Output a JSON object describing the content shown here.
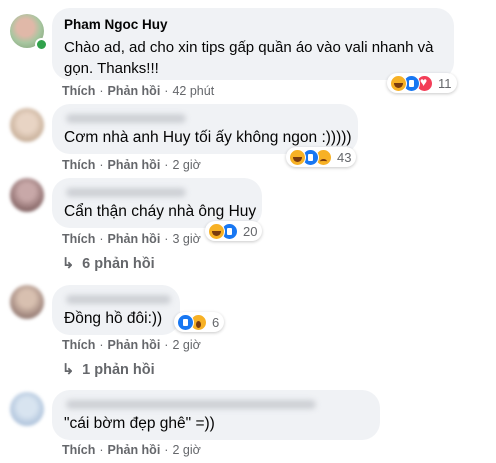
{
  "colors": {
    "bubble": "#f0f2f5",
    "muted": "#65676b",
    "online": "#31a24c",
    "like": "#1877f2",
    "love": "#f33e58",
    "haha": "#f7b125"
  },
  "action_labels": {
    "like": "Thích",
    "reply": "Phản hồi"
  },
  "comments": [
    {
      "author": "Pham Ngoc Huy",
      "lines": [
        "Chào ad, ad cho xin tips gấp quần áo vào vali nhanh và",
        "gọn. Thanks!!!"
      ],
      "time": "42 phút",
      "reaction_icons": [
        "haha-icon",
        "like-icon",
        "love-icon"
      ],
      "reaction_count": "11"
    },
    {
      "author": "",
      "lines": [
        "Cơm nhà anh Huy tối ấy không ngon :)))))"
      ],
      "time": "2 giờ",
      "reaction_icons": [
        "haha-icon",
        "like-icon",
        "sad-icon"
      ],
      "reaction_count": "43"
    },
    {
      "author": "",
      "lines": [
        "Cẩn thận cháy nhà ông Huy"
      ],
      "time": "3 giờ",
      "reaction_icons": [
        "haha-icon",
        "like-icon"
      ],
      "reaction_count": "20",
      "replies": "6 phản hồi"
    },
    {
      "author": "",
      "lines": [
        "Đồng hồ đôi:))"
      ],
      "time": "2 giờ",
      "reaction_icons": [
        "like-icon",
        "wow-icon"
      ],
      "reaction_count": "6",
      "replies": "1 phản hồi"
    },
    {
      "author": "",
      "lines": [
        "\"cái bờm đẹp ghê\" =))"
      ],
      "time": "2 giờ",
      "reaction_icons": [],
      "reaction_count": ""
    }
  ]
}
